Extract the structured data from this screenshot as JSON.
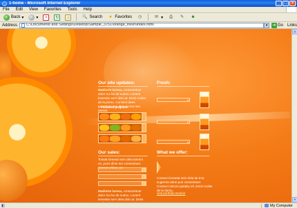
{
  "window": {
    "title": "1-home - Microsoft Internet Explorer"
  },
  "menu": [
    "File",
    "Edit",
    "View",
    "Favorites",
    "Tools",
    "Help"
  ],
  "toolbar": {
    "back": "Back",
    "search": "Search",
    "favorites": "Favorites"
  },
  "address": {
    "label": "Address",
    "url": "C:\\Documents and Settings\\Desktop\\Sample_3751\\orange_fresh\\index.html",
    "go": "Go",
    "links": "Links"
  },
  "status": {
    "zone": "My Computer"
  },
  "page": {
    "updates": {
      "title": "Our site updates:",
      "text_bold": "Madiorte luresa,",
      "text": "consectetuer dolor trui lar de sutmu. Lonerit lesrestie sem dolo at. Dreis rnolier de la pirmo. Consect dees Ioreetnat vere dela lucrea nes. Mesite.",
      "featured": "» Featured projects"
    },
    "fresh": {
      "title": "Fresh:"
    },
    "sales": {
      "title": "Our sales:",
      "text": "Tosala loreetat sem dela lareum es, pues dime ser conseintuer. Conset crlose, pe",
      "bottom_bold": "Madiorte luresa,",
      "bottom_text": "consectetuer dolor trui lar de sutmu. Lonerit lesrestie sem dela dolo at. Dreis rnolier de la pirmo."
    },
    "offer": {
      "title": "What we offer:",
      "text": "Consect loreetat sem dela lar trus sugemta ratne pue conseintuer. Consect netcos paralsy eli. Dreis molier de la dumu.",
      "link": "visit portfolio section"
    }
  }
}
